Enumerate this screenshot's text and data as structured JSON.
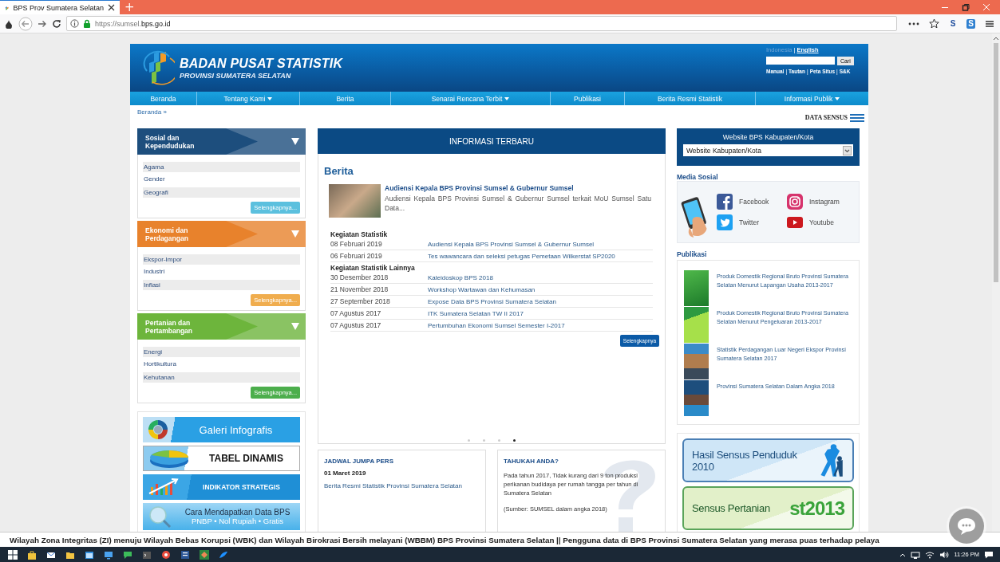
{
  "browser": {
    "tab": {
      "title": "BPS Prov Sumatera Selatan",
      "selected": true
    },
    "new_tab": "+",
    "url": "https://sumsel.**bps.go.id**",
    "extensions": [
      "S",
      "S"
    ]
  },
  "header": {
    "title": "BADAN PUSAT STATISTIK",
    "subtitle": "PROVINSI SUMATERA SELATAN",
    "separator": "|",
    "languages": [
      {
        "label": "Indonesia",
        "selected": true
      },
      {
        "label": "English",
        "selected": false
      }
    ],
    "search_button": "Cari",
    "links": [
      "Manual",
      "Tautan",
      "Peta Situs",
      "S&K"
    ]
  },
  "nav": [
    {
      "label": "Beranda",
      "dropdown": false
    },
    {
      "label": "Tentang Kami",
      "dropdown": true
    },
    {
      "label": "Berita",
      "dropdown": false
    },
    {
      "label": "Senarai Rencana Terbit",
      "dropdown": true
    },
    {
      "label": "Publikasi",
      "dropdown": false
    },
    {
      "label": "Berita Resmi Statistik",
      "dropdown": false
    },
    {
      "label": "Informasi Publik",
      "dropdown": true
    }
  ],
  "breadcrumb": "Beranda »",
  "data_sensus": "DATA SENSUS",
  "categories": [
    {
      "title": "Sosial dan Kependudukan",
      "color": "#1d4e7d",
      "items": [
        "Agama",
        "Gender",
        "Geografi"
      ],
      "button": {
        "label": "Selengkapnya...",
        "color": "#5bc0de"
      }
    },
    {
      "title": "Ekonomi dan Perdagangan",
      "color": "#e8822c",
      "items": [
        "Ekspor-Impor",
        "Industri",
        "Inflasi"
      ],
      "button": {
        "label": "Selengkapnya...",
        "color": "#f0ad4e"
      }
    },
    {
      "title": "Pertanian dan Pertambangan",
      "color": "#6db53c",
      "items": [
        "Energi",
        "Hortikultura",
        "Kehutanan"
      ],
      "button": {
        "label": "Selengkapnya...",
        "color": "#4cae4c"
      }
    }
  ],
  "left_banners": [
    {
      "kind": "infografis",
      "text": "Galeri Infografis"
    },
    {
      "kind": "tabel",
      "text": "TABEL DINAMIS"
    },
    {
      "kind": "indikator",
      "text": "INDIKATOR STRATEGIS"
    },
    {
      "kind": "cara",
      "text": "Cara Mendapatkan Data BPS",
      "subtext": "PNBP • Nol Rupiah • Gratis"
    }
  ],
  "news": {
    "header": "INFORMASI TERBARU",
    "section": "Berita",
    "featured": {
      "title": "Audiensi Kepala BPS Provinsi Sumsel & Gubernur Sumsel",
      "summary": "Audiensi Kepala BPS Provinsi Sumsel & Gubernur Sumsel terkait MoU Sumsel Satu Data..."
    },
    "groups": [
      {
        "title": "Kegiatan Statistik",
        "rows": [
          {
            "date": "08 Februari 2019",
            "title": "Audiensi Kepala BPS Provinsi Sumsel & Gubernur Sumsel"
          },
          {
            "date": "06 Februari 2019",
            "title": "Tes wawancara dan seleksi petugas Pemetaan Wilkerstat SP2020"
          }
        ]
      },
      {
        "title": "Kegiatan Statistik Lainnya",
        "rows": [
          {
            "date": "30 Desember 2018",
            "title": "Kaleidoskop BPS 2018"
          },
          {
            "date": "21 November 2018",
            "title": "Workshop Wartawan dan Kehumasan"
          },
          {
            "date": "27 September 2018",
            "title": "Expose Data BPS Provinsi Sumatera Selatan"
          },
          {
            "date": "07 Agustus 2017",
            "title": "ITK Sumatera Selatan TW II 2017"
          },
          {
            "date": "07 Agustus 2017",
            "title": "Pertumbuhan Ekonomi Sumsel Semester I-2017"
          }
        ]
      }
    ],
    "more": "Selengkapnya",
    "pages": [
      {
        "selected": false
      },
      {
        "selected": false
      },
      {
        "selected": false
      },
      {
        "selected": true
      }
    ]
  },
  "press": {
    "title": "JADWAL JUMPA PERS",
    "date": "01 Maret 2019",
    "link": "Berita Resmi Statistik Provinsi Sumatera Selatan"
  },
  "fact": {
    "title": "TAHUKAH ANDA?",
    "text": "Pada tahun 2017, Tidak kurang dari 9 ton produksi perikanan budidaya per rumah tangga per tahun di Sumatera Selatan",
    "source": "(Sumber: SUMSEL dalam angka 2018)"
  },
  "regency": {
    "title": "Website BPS Kabupaten/Kota",
    "select": "Website Kabupaten/Kota"
  },
  "social": {
    "title": "Media Sosial",
    "items": [
      {
        "kind": "facebook",
        "label": "Facebook"
      },
      {
        "kind": "instagram",
        "label": "Instagram"
      },
      {
        "kind": "twitter",
        "label": "Twitter"
      },
      {
        "kind": "youtube",
        "label": "Youtube"
      }
    ]
  },
  "publications": {
    "title": "Publikasi",
    "items": [
      "Produk Domestik Regional Bruto Provinsi Sumatera Selatan Menurut Lapangan Usaha 2013-2017",
      "Produk Domestik Regional Bruto Provinsi Sumatera Selatan Menurut Pengeluaran 2013-2017",
      "Statistik Perdagangan Luar Negeri Ekspor Provinsi Sumatera Selatan 2017",
      "Provinsi Sumatera Selatan Dalam Angka 2018"
    ]
  },
  "right_banners": [
    {
      "kind": "sensus_penduduk",
      "text": "Hasil Sensus Penduduk 2010"
    },
    {
      "kind": "sensus_pertanian",
      "text": "Sensus Pertanian",
      "logo": "st2013"
    }
  ],
  "ticker": "Wilayah Zona Integritas (ZI) menuju Wilayah Bebas Korupsi (WBK) dan Wilayah Birokrasi Bersih melayani (WBBM) BPS Provinsi Sumatera Selatan || Pengguna data di BPS Provinsi Sumatera Selatan yang merasa puas terhadap pelaya",
  "taskbar": {
    "clock": "11:26 PM"
  }
}
